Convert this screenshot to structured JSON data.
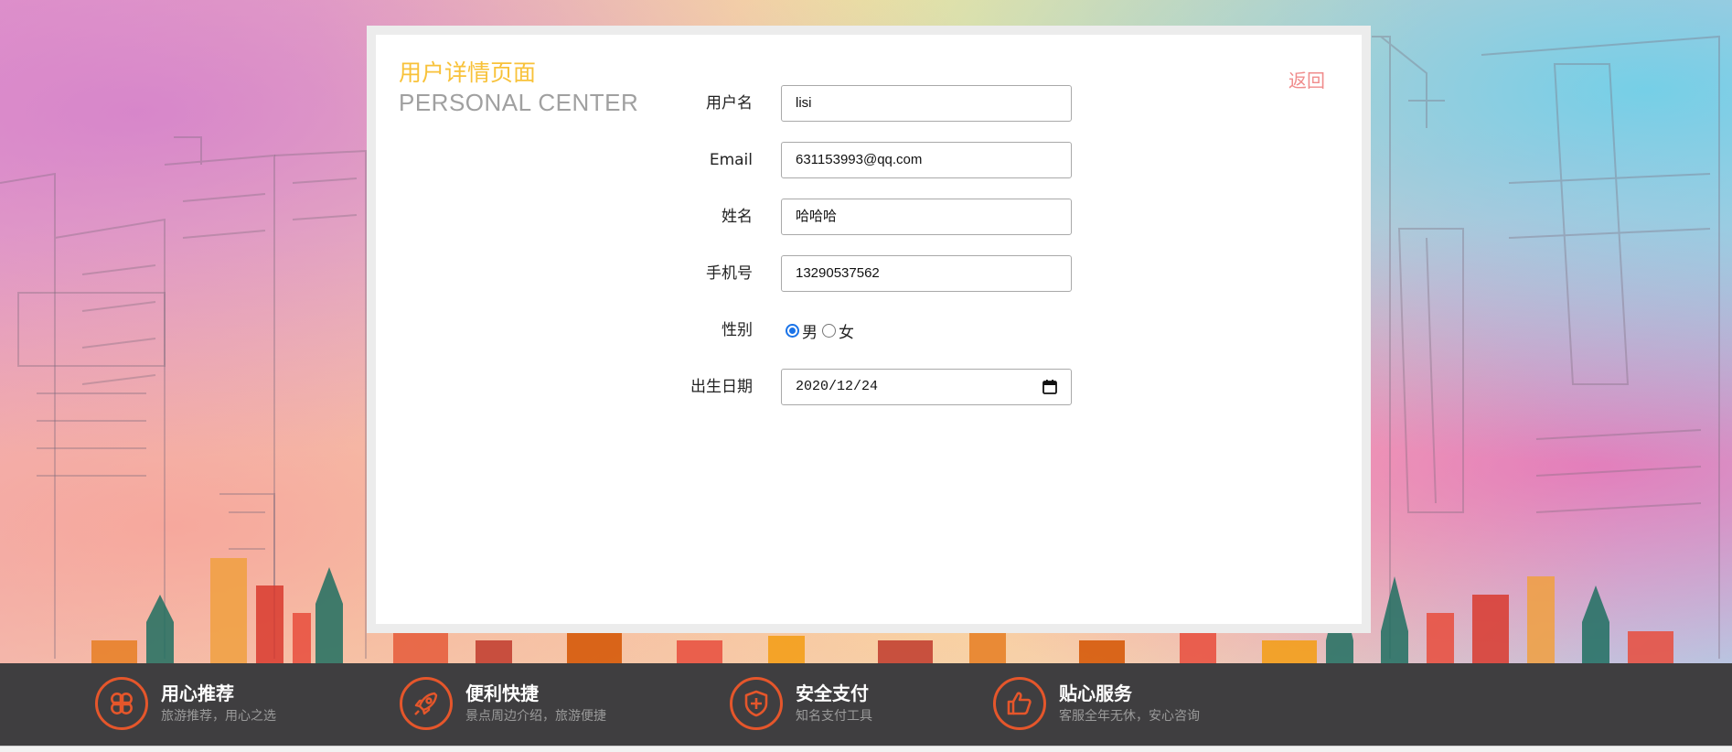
{
  "panel": {
    "title_cn": "用户详情页面",
    "title_en": "PERSONAL CENTER",
    "back_label": "返回"
  },
  "form": {
    "username_label": "用户名",
    "username_value": "lisi",
    "email_label": "Email",
    "email_value": "631153993@qq.com",
    "name_label": "姓名",
    "name_value": "哈哈哈",
    "phone_label": "手机号",
    "phone_value": "13290537562",
    "gender_label": "性别",
    "gender_options": [
      "男",
      "女"
    ],
    "gender_selected": "男",
    "birthday_label": "出生日期",
    "birthday_value": "2020/12/24"
  },
  "footer": {
    "accent_color": "#e5562b",
    "features": [
      {
        "title": "用心推荐",
        "subtitle": "旅游推荐，用心之选",
        "icon": "clover-icon"
      },
      {
        "title": "便利快捷",
        "subtitle": "景点周边介绍，旅游便捷",
        "icon": "rocket-icon"
      },
      {
        "title": "安全支付",
        "subtitle": "知名支付工具",
        "icon": "shield-icon"
      },
      {
        "title": "贴心服务",
        "subtitle": "客服全年无休，安心咨询",
        "icon": "thumbs-up-icon"
      }
    ]
  }
}
